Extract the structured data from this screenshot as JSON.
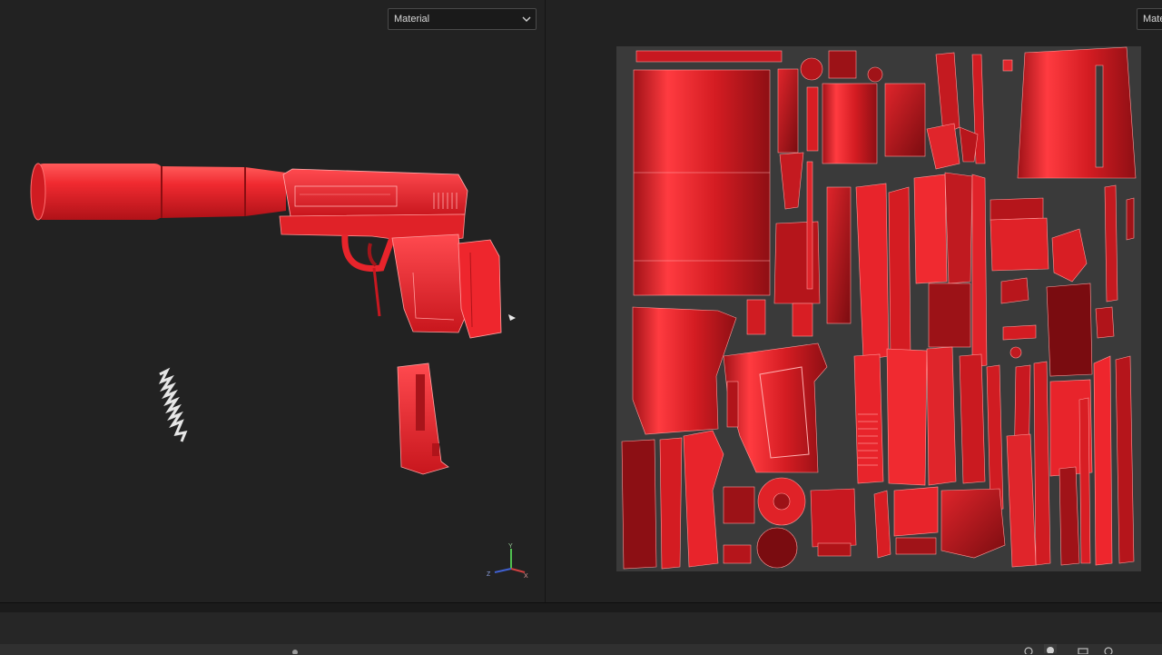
{
  "viewport_3d": {
    "material_dropdown": {
      "value": "Material",
      "icon": "chevron-down-icon"
    },
    "axis_gizmo": {
      "labels": [
        "Y",
        "Z",
        "X"
      ]
    }
  },
  "viewport_uv": {
    "material_dropdown": {
      "value": "Mate"
    }
  },
  "colors": {
    "background": "#222222",
    "model_red": "#e8242b",
    "uv_canvas": "#3a3a3a",
    "axis_x": "#d04040",
    "axis_y": "#50c050",
    "axis_z": "#4060d0"
  }
}
